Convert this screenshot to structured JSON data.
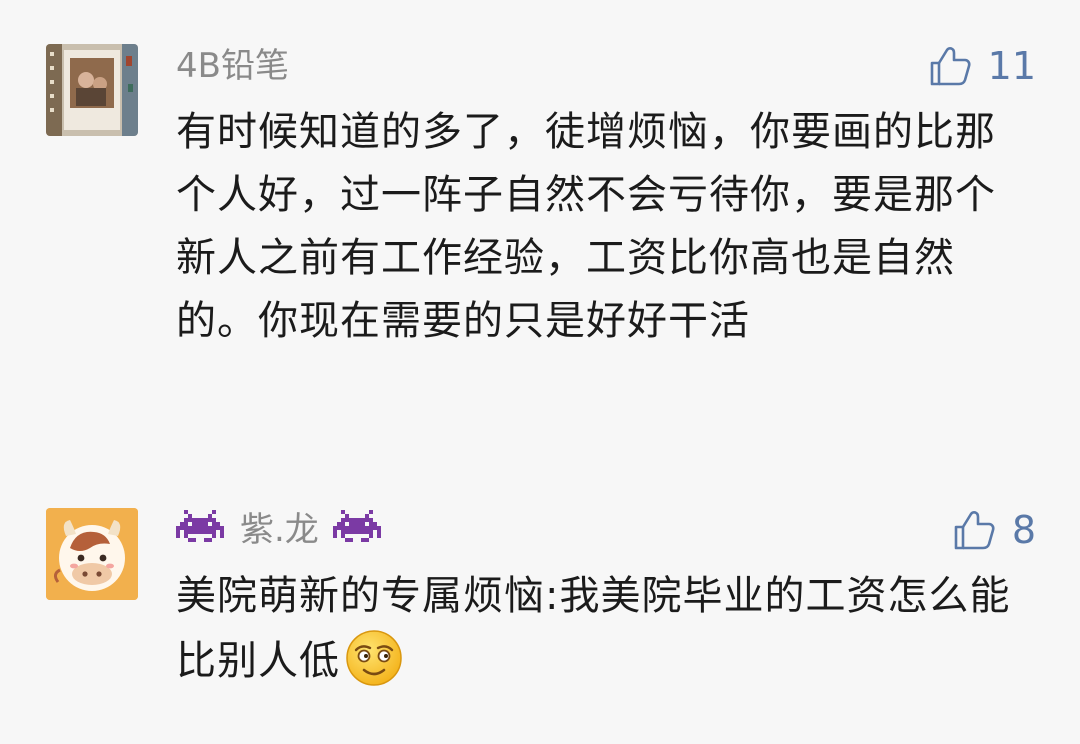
{
  "comments": [
    {
      "nickname": "4B铅笔",
      "likes": "11",
      "text": "有时候知道的多了，徒增烦恼，你要画的比那个人好，过一阵子自然不会亏待你，要是那个新人之前有工作经验，工资比你高也是自然的。你现在需要的只是好好干活"
    },
    {
      "nickname": "紫.龙",
      "nickname_decoration": "space-invader-emoji",
      "likes": "8",
      "text": "美院萌新的专属烦恼:我美院毕业的工资怎么能比别人低",
      "trailing_emoji": "relieved-face-emoji"
    }
  ],
  "colors": {
    "background": "#f7f7f7",
    "nickname": "#8a8a8a",
    "like": "#5a79a8",
    "text": "#1b1b1b"
  }
}
